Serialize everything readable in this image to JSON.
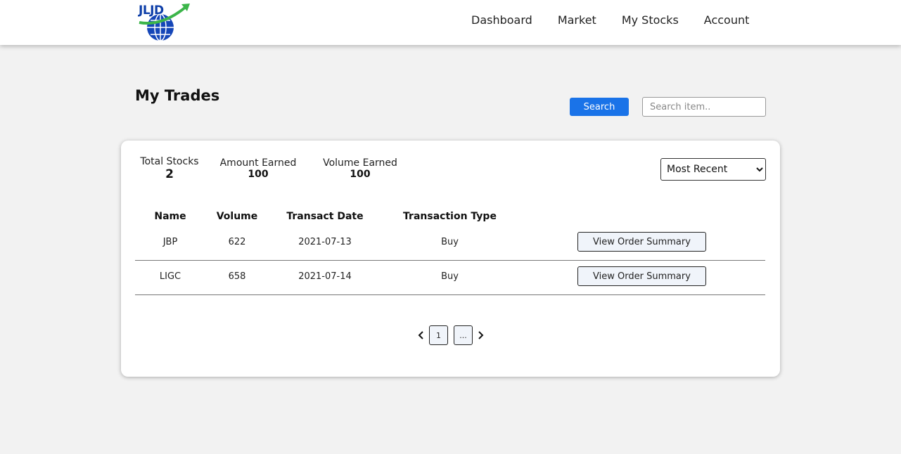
{
  "brand": {
    "logo_text": "JLJD"
  },
  "nav": {
    "items": [
      {
        "label": "Dashboard"
      },
      {
        "label": "Market"
      },
      {
        "label": "My Stocks"
      },
      {
        "label": "Account"
      }
    ]
  },
  "page": {
    "title": "My Trades",
    "search_label": "Search",
    "search_placeholder": "Search item.."
  },
  "summary": {
    "total_stocks": {
      "label": "Total Stocks",
      "value": "2"
    },
    "amount_earned": {
      "label": "Amount Earned",
      "value": "100"
    },
    "volume_earned": {
      "label": "Volume Earned",
      "value": "100"
    },
    "sort": {
      "selected": "Most Recent"
    }
  },
  "table": {
    "headers": {
      "name": "Name",
      "volume": "Volume",
      "date": "Transact Date",
      "type": "Transaction Type"
    },
    "rows": [
      {
        "name": "JBP",
        "volume": "622",
        "date": "2021-07-13",
        "type": "Buy",
        "action": "View Order Summary"
      },
      {
        "name": "LIGC",
        "volume": "658",
        "date": "2021-07-14",
        "type": "Buy",
        "action": "View Order Summary"
      }
    ]
  },
  "pagination": {
    "pages": [
      "1",
      "..."
    ]
  },
  "colors": {
    "accent": "#1a73e8",
    "background": "#f2f2f2",
    "logo_blue": "#0d3ea8",
    "logo_green": "#3cb54a"
  },
  "icons": {
    "prev": "chevron-left-icon",
    "next": "chevron-right-icon",
    "select": "chevron-down-icon"
  }
}
